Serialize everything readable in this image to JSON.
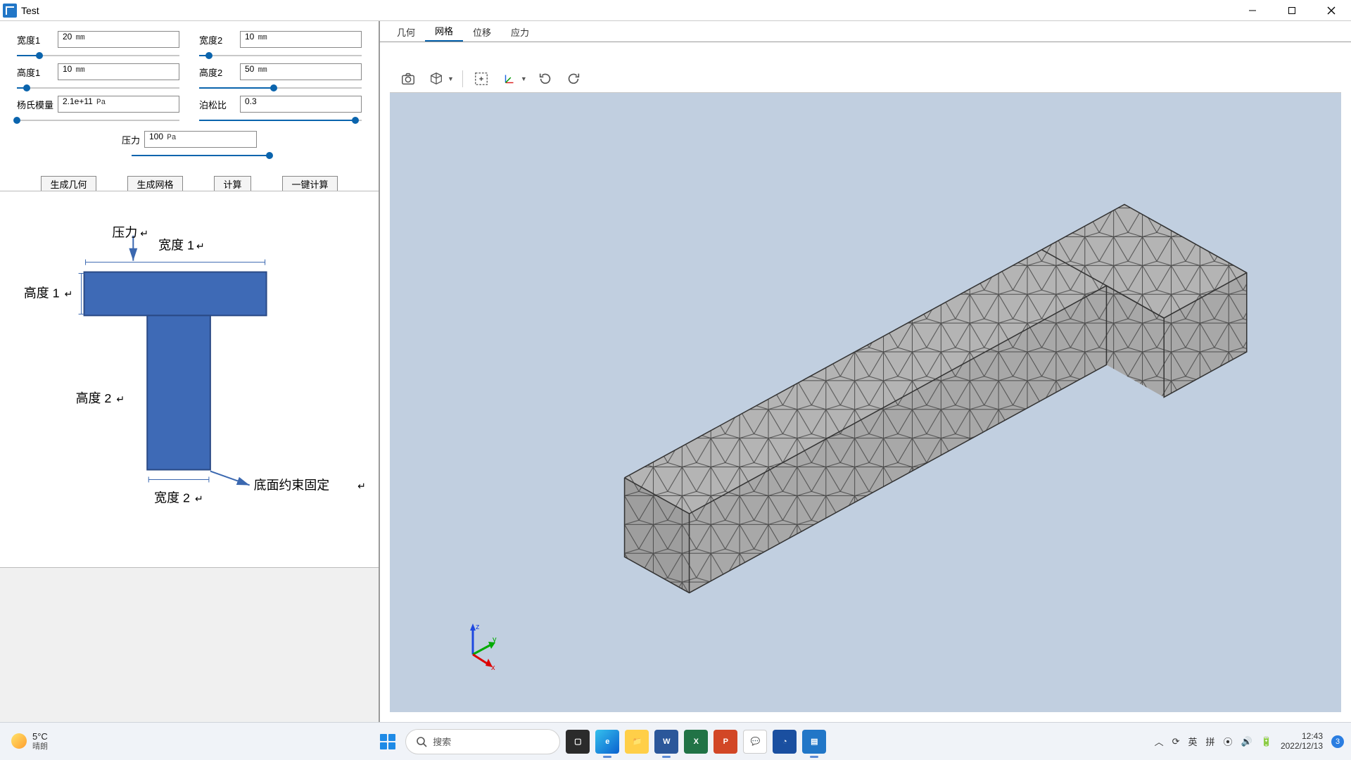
{
  "window": {
    "title": "Test"
  },
  "params": {
    "width1": {
      "label": "宽度1",
      "value": "20",
      "unit": "mm",
      "pct": 14
    },
    "width2": {
      "label": "宽度2",
      "value": "10",
      "unit": "mm",
      "pct": 6
    },
    "height1": {
      "label": "高度1",
      "value": "10",
      "unit": "mm",
      "pct": 6
    },
    "height2": {
      "label": "高度2",
      "value": "50",
      "unit": "mm",
      "pct": 46
    },
    "youngs": {
      "label": "杨氏模量",
      "value": "2.1e+11",
      "unit": "Pa",
      "pct": 0
    },
    "poisson": {
      "label": "泊松比",
      "value": "0.3",
      "unit": "",
      "pct": 96
    },
    "pressure": {
      "label": "压力",
      "value": "100",
      "unit": "Pa",
      "pct": 98
    }
  },
  "buttons": {
    "gen_geom": "生成几何",
    "gen_mesh": "生成网格",
    "calc": "计算",
    "one_click": "一键计算"
  },
  "schematic": {
    "pressure": "压力",
    "width1": "宽度 1",
    "width2": "宽度 2",
    "height1": "高度 1",
    "height2": "高度 2",
    "fixed": "底面约束固定"
  },
  "tabs": {
    "geometry": "几何",
    "mesh": "网格",
    "disp": "位移",
    "stress": "应力",
    "active": "mesh"
  },
  "taskbar": {
    "temp": "5°C",
    "weather": "晴朗",
    "search_placeholder": "搜索",
    "ime1": "英",
    "ime2": "拼",
    "time": "12:43",
    "date": "2022/12/13",
    "notif_count": "3"
  }
}
